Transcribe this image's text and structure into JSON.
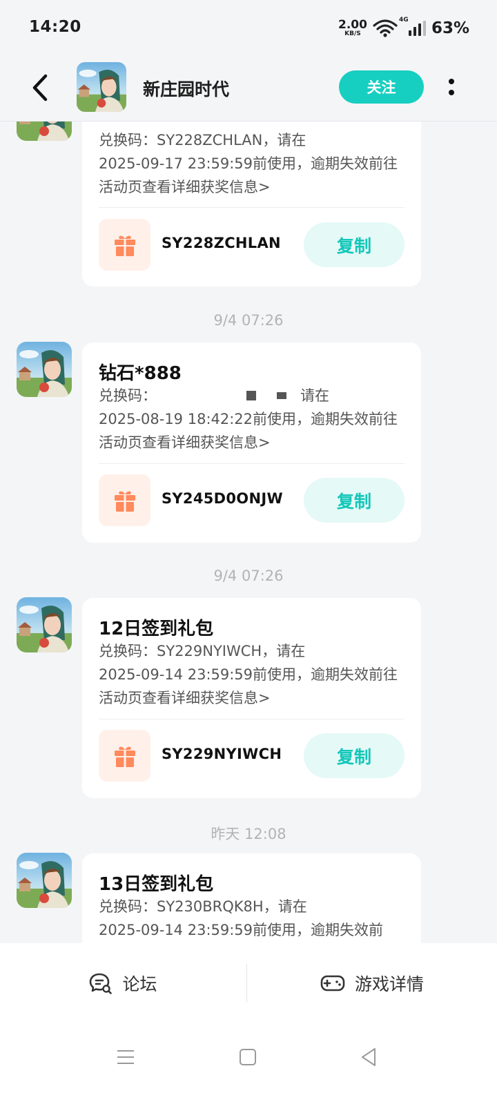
{
  "status_bar": {
    "time": "14:20",
    "net_speed": "2.00",
    "net_unit": "KB/S",
    "network_type": "4G",
    "battery": "63%"
  },
  "header": {
    "title": "新庄园时代",
    "follow_label": "关注"
  },
  "feed": {
    "partial_card": {
      "code_label": "兑换码：SY228ZCHLAN，请在",
      "desc": "2025-09-17 23:59:59前使用，逾期失效前往活动页查看详细获奖信息>",
      "code": "SY228ZCHLAN",
      "copy_label": "复制"
    },
    "messages": [
      {
        "time": "9/4  07:26",
        "title": "钻石*888",
        "code_label": "兑换码：",
        "code_label_tail": "请在",
        "desc": "2025-08-19 18:42:22前使用，逾期失效前往活动页查看详细获奖信息>",
        "code": "SY245D0ONJW",
        "copy_label": "复制"
      },
      {
        "time": "9/4  07:26",
        "title": "12日签到礼包",
        "code_label": "兑换码：SY229NYIWCH，请在",
        "desc": "2025-09-14 23:59:59前使用，逾期失效前往活动页查看详细获奖信息>",
        "code": "SY229NYIWCH",
        "copy_label": "复制"
      },
      {
        "time": "昨天  12:08",
        "title": "13日签到礼包",
        "code_label": "兑换码：SY230BRQK8H，请在",
        "desc": "2025-09-14 23:59:59前使用，逾期失效前"
      }
    ]
  },
  "bottom_tabs": {
    "forum": "论坛",
    "game_details": "游戏详情"
  },
  "colors": {
    "accent": "#16cfc1",
    "copy_bg": "#e5f9f7",
    "gift_bg": "#fff0ea",
    "gift_icon": "#ff8a5c",
    "background": "#f4f5f7"
  }
}
